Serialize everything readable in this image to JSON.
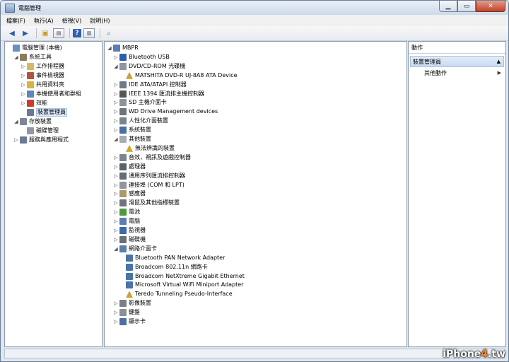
{
  "window": {
    "title": "電腦管理"
  },
  "menu": [
    "檔案(F)",
    "執行(A)",
    "檢視(V)",
    "說明(H)"
  ],
  "left_tree": [
    {
      "label": "電腦管理 (本機)",
      "depth": 0,
      "arrow": "",
      "icon": "computer-management-icon"
    },
    {
      "label": "系統工具",
      "depth": 1,
      "arrow": "◢",
      "icon": "system-tools-icon"
    },
    {
      "label": "工作排程器",
      "depth": 2,
      "arrow": "▷",
      "icon": "task-scheduler-icon"
    },
    {
      "label": "事件檢視器",
      "depth": 2,
      "arrow": "▷",
      "icon": "event-viewer-icon"
    },
    {
      "label": "共用資料夾",
      "depth": 2,
      "arrow": "▷",
      "icon": "shared-folders-icon"
    },
    {
      "label": "本機使用者和群組",
      "depth": 2,
      "arrow": "▷",
      "icon": "local-users-icon"
    },
    {
      "label": "效能",
      "depth": 2,
      "arrow": "▷",
      "icon": "performance-icon"
    },
    {
      "label": "裝置管理員",
      "depth": 2,
      "arrow": "",
      "icon": "device-manager-icon",
      "selected": true
    },
    {
      "label": "存放裝置",
      "depth": 1,
      "arrow": "◢",
      "icon": "storage-icon"
    },
    {
      "label": "磁碟管理",
      "depth": 2,
      "arrow": "",
      "icon": "disk-management-icon"
    },
    {
      "label": "服務與應用程式",
      "depth": 1,
      "arrow": "▷",
      "icon": "services-icon"
    }
  ],
  "device_tree": [
    {
      "label": "MBPR",
      "depth": 0,
      "arrow": "◢",
      "icon": "computer-icon"
    },
    {
      "label": "Bluetooth USB",
      "depth": 1,
      "arrow": "▷",
      "icon": "bluetooth-icon"
    },
    {
      "label": "DVD/CD-ROM 光碟機",
      "depth": 1,
      "arrow": "◢",
      "icon": "dvd-drive-icon"
    },
    {
      "label": "MATSHITA DVD-R   UJ-8A8 ATA Device",
      "depth": 2,
      "arrow": "",
      "icon": "dvd-device-warning-icon"
    },
    {
      "label": "IDE ATA/ATAPI 控制器",
      "depth": 1,
      "arrow": "▷",
      "icon": "ide-controller-icon"
    },
    {
      "label": "IEEE 1394 匯流排主機控制器",
      "depth": 1,
      "arrow": "▷",
      "icon": "firewire-icon"
    },
    {
      "label": "SD 主機介面卡",
      "depth": 1,
      "arrow": "▷",
      "icon": "sd-host-icon"
    },
    {
      "label": "WD Drive Management devices",
      "depth": 1,
      "arrow": "▷",
      "icon": "wd-drive-icon"
    },
    {
      "label": "人性化介面裝置",
      "depth": 1,
      "arrow": "▷",
      "icon": "hid-icon"
    },
    {
      "label": "系統裝置",
      "depth": 1,
      "arrow": "▷",
      "icon": "system-devices-icon"
    },
    {
      "label": "其他裝置",
      "depth": 1,
      "arrow": "◢",
      "icon": "other-devices-icon"
    },
    {
      "label": "無法辨識的裝置",
      "depth": 2,
      "arrow": "",
      "icon": "unknown-device-warning-icon"
    },
    {
      "label": "音效，視訊及遊戲控制器",
      "depth": 1,
      "arrow": "▷",
      "icon": "sound-icon"
    },
    {
      "label": "處理器",
      "depth": 1,
      "arrow": "▷",
      "icon": "processor-icon"
    },
    {
      "label": "通用序列匯流排控制器",
      "depth": 1,
      "arrow": "▷",
      "icon": "usb-icon"
    },
    {
      "label": "連接埠 (COM 和 LPT)",
      "depth": 1,
      "arrow": "▷",
      "icon": "ports-icon"
    },
    {
      "label": "感應器",
      "depth": 1,
      "arrow": "▷",
      "icon": "sensor-icon"
    },
    {
      "label": "滑鼠及其他指標裝置",
      "depth": 1,
      "arrow": "▷",
      "icon": "mouse-icon"
    },
    {
      "label": "電池",
      "depth": 1,
      "arrow": "▷",
      "icon": "battery-icon"
    },
    {
      "label": "電腦",
      "depth": 1,
      "arrow": "▷",
      "icon": "computer-icon"
    },
    {
      "label": "監視器",
      "depth": 1,
      "arrow": "▷",
      "icon": "monitor-icon"
    },
    {
      "label": "磁碟機",
      "depth": 1,
      "arrow": "▷",
      "icon": "disk-drive-icon"
    },
    {
      "label": "網路介面卡",
      "depth": 1,
      "arrow": "◢",
      "icon": "network-adapter-icon"
    },
    {
      "label": "Bluetooth PAN Network Adapter",
      "depth": 2,
      "arrow": "",
      "icon": "network-card-icon"
    },
    {
      "label": "Broadcom 802.11n 網路卡",
      "depth": 2,
      "arrow": "",
      "icon": "network-card-icon"
    },
    {
      "label": "Broadcom NetXtreme Gigabit Ethernet",
      "depth": 2,
      "arrow": "",
      "icon": "network-card-icon"
    },
    {
      "label": "Microsoft Virtual WiFi Miniport Adapter",
      "depth": 2,
      "arrow": "",
      "icon": "network-card-icon"
    },
    {
      "label": "Teredo Tunneling Pseudo-Interface",
      "depth": 2,
      "arrow": "",
      "icon": "network-card-warning-icon"
    },
    {
      "label": "影像裝置",
      "depth": 1,
      "arrow": "▷",
      "icon": "imaging-icon"
    },
    {
      "label": "鍵盤",
      "depth": 1,
      "arrow": "▷",
      "icon": "keyboard-icon"
    },
    {
      "label": "顯示卡",
      "depth": 1,
      "arrow": "▷",
      "icon": "display-adapter-icon"
    }
  ],
  "actions": {
    "header": "動作",
    "section": "裝置管理員",
    "item": "其他動作"
  },
  "watermark": {
    "prefix": "iPhone",
    "four": "4",
    "suffix": ".tw"
  },
  "colors": {
    "selection": "#dde9f7",
    "titlebar": "#cfdbea",
    "close": "#c0432b"
  }
}
